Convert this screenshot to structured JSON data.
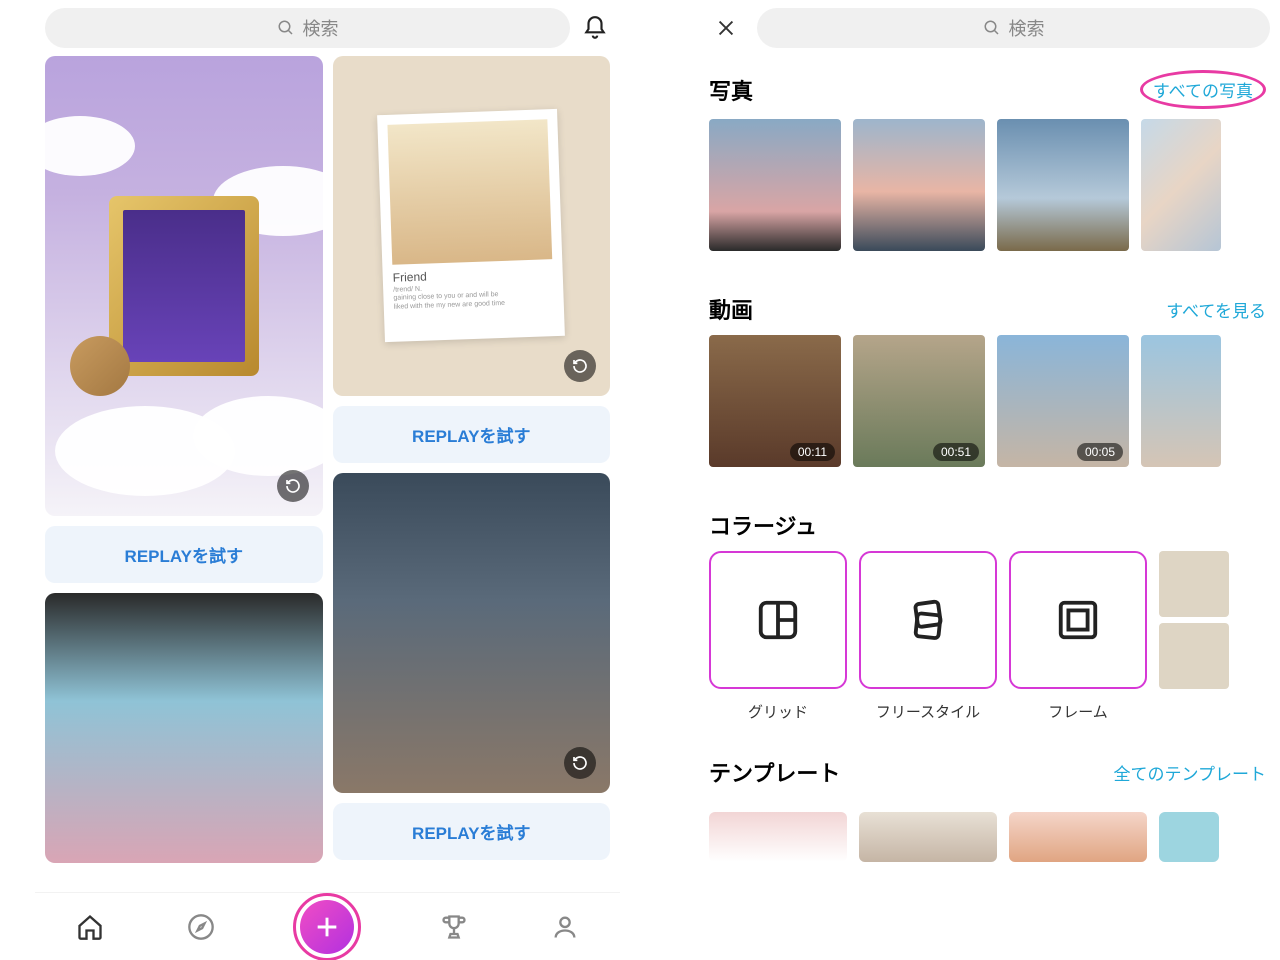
{
  "left": {
    "search_placeholder": "検索",
    "polaroid_caption": "Friend",
    "replay_try": "REPLAYを試す"
  },
  "right": {
    "search_placeholder": "検索",
    "photos": {
      "title": "写真",
      "link": "すべての写真"
    },
    "videos": {
      "title": "動画",
      "link": "すべてを見る",
      "durations": [
        "00:11",
        "00:51",
        "00:05"
      ]
    },
    "collage": {
      "title": "コラージュ",
      "labels": [
        "グリッド",
        "フリースタイル",
        "フレーム"
      ]
    },
    "templates": {
      "title": "テンプレート",
      "link": "全てのテンプレート"
    }
  }
}
